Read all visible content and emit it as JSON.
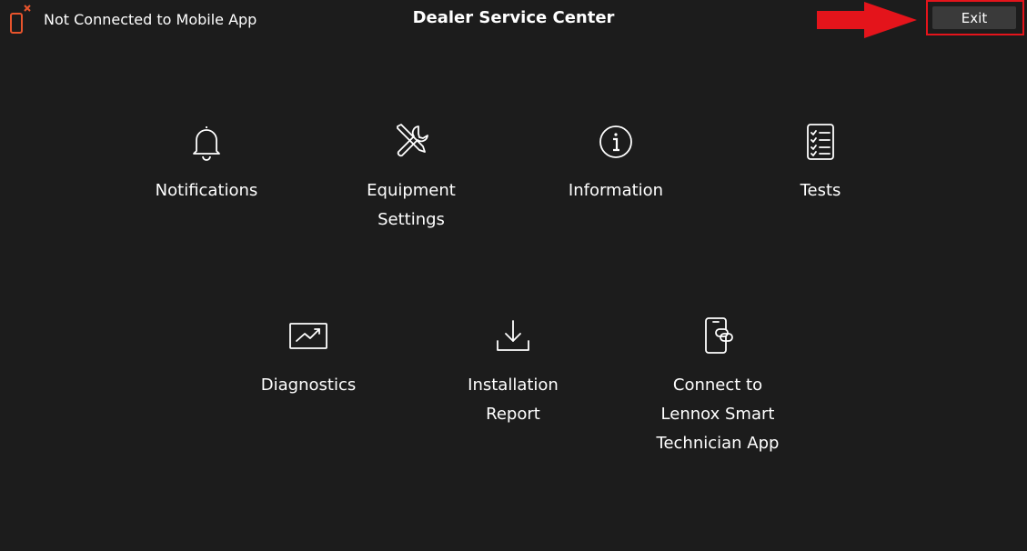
{
  "header": {
    "connection_status": "Not Connected to Mobile App",
    "title": "Dealer Service Center",
    "exit_label": "Exit"
  },
  "menu": {
    "items": [
      {
        "id": "notifications",
        "label_lines": [
          "Notifications"
        ],
        "icon": "bell-icon"
      },
      {
        "id": "equipment-settings",
        "label_lines": [
          "Equipment",
          "Settings"
        ],
        "icon": "tools-icon"
      },
      {
        "id": "information",
        "label_lines": [
          "Information"
        ],
        "icon": "info-icon"
      },
      {
        "id": "tests",
        "label_lines": [
          "Tests"
        ],
        "icon": "checklist-icon"
      },
      {
        "id": "diagnostics",
        "label_lines": [
          "Diagnostics"
        ],
        "icon": "trend-chart-icon"
      },
      {
        "id": "installation-report",
        "label_lines": [
          "Installation",
          "Report"
        ],
        "icon": "download-icon"
      },
      {
        "id": "connect-smart-tech",
        "label_lines": [
          "Connect to",
          "Lennox Smart",
          "Technician App"
        ],
        "icon": "phone-link-icon"
      }
    ]
  },
  "colors": {
    "background": "#1c1c1c",
    "text": "#ffffff",
    "warning_icon": "#e8542c",
    "annotation": "#e4141b",
    "exit_button": "#3a3a3a"
  }
}
